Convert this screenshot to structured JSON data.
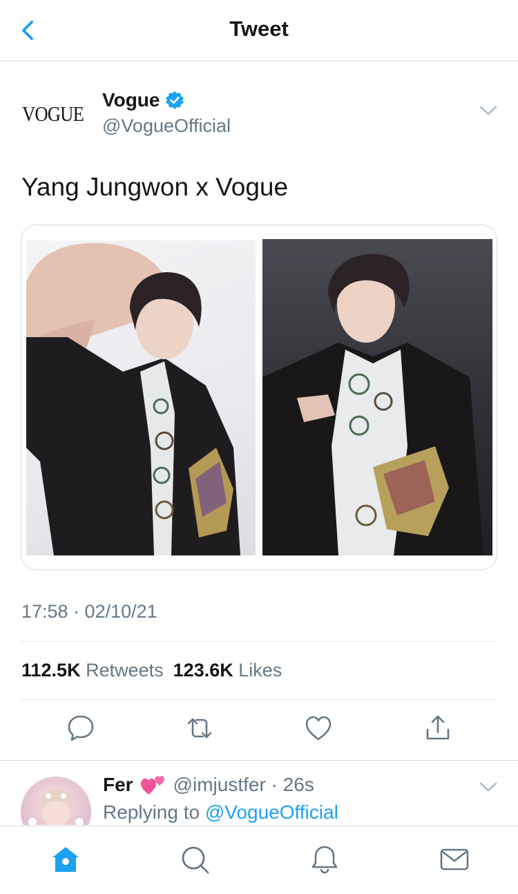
{
  "nav": {
    "title": "Tweet",
    "back_icon": "chevron-left-icon"
  },
  "author": {
    "logo_text": "VOGUE",
    "name": "Vogue",
    "handle": "@VogueOfficial",
    "verified": true
  },
  "tweet": {
    "text": "Yang Jungwon x Vogue",
    "timestamp": "17:58 · 02/10/21",
    "media": [
      {
        "description": "magazine page photo 1"
      },
      {
        "description": "magazine page photo 2"
      }
    ]
  },
  "stats": {
    "retweets_count": "112.5K",
    "retweets_label": "Retweets",
    "likes_count": "123.6K",
    "likes_label": "Likes"
  },
  "actions": [
    "reply-icon",
    "retweet-icon",
    "like-icon",
    "share-icon"
  ],
  "reply": {
    "name": "Fer",
    "meta": "@imjustfer · 26s",
    "replying_prefix": "Replying to ",
    "replying_handle": "@VogueOfficial"
  },
  "tabbar": [
    "home-icon",
    "search-icon",
    "notifications-icon",
    "messages-icon"
  ],
  "colors": {
    "accent": "#1da1f2",
    "secondary_text": "#657786",
    "divider": "#e1e5e8"
  }
}
